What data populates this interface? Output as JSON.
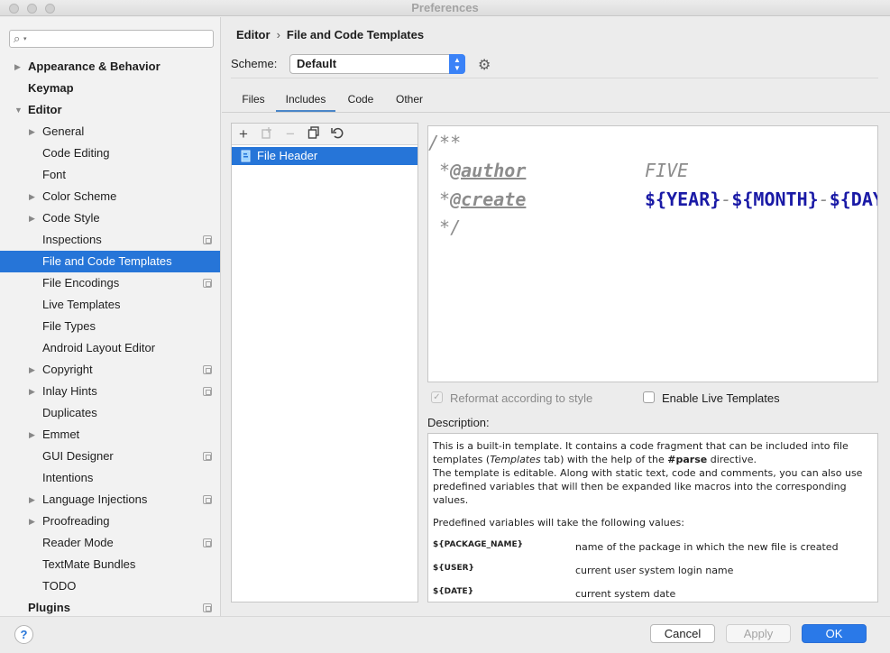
{
  "window": {
    "title": "Preferences"
  },
  "search": {
    "placeholder": "",
    "icon": "search-icon"
  },
  "sidebar": {
    "items": [
      {
        "label": "Appearance & Behavior",
        "level": 0,
        "bold": true,
        "expandable": true,
        "expanded": false,
        "badge": false
      },
      {
        "label": "Keymap",
        "level": 0,
        "bold": true,
        "expandable": false,
        "badge": false
      },
      {
        "label": "Editor",
        "level": 0,
        "bold": true,
        "expandable": true,
        "expanded": true,
        "badge": false
      },
      {
        "label": "General",
        "level": 1,
        "expandable": true,
        "badge": false
      },
      {
        "label": "Code Editing",
        "level": 1,
        "expandable": false,
        "badge": false
      },
      {
        "label": "Font",
        "level": 1,
        "expandable": false,
        "badge": false
      },
      {
        "label": "Color Scheme",
        "level": 1,
        "expandable": true,
        "badge": false
      },
      {
        "label": "Code Style",
        "level": 1,
        "expandable": true,
        "badge": false
      },
      {
        "label": "Inspections",
        "level": 1,
        "expandable": false,
        "badge": true
      },
      {
        "label": "File and Code Templates",
        "level": 1,
        "expandable": false,
        "badge": false,
        "selected": true
      },
      {
        "label": "File Encodings",
        "level": 1,
        "expandable": false,
        "badge": true
      },
      {
        "label": "Live Templates",
        "level": 1,
        "expandable": false,
        "badge": false
      },
      {
        "label": "File Types",
        "level": 1,
        "expandable": false,
        "badge": false
      },
      {
        "label": "Android Layout Editor",
        "level": 1,
        "expandable": false,
        "badge": false
      },
      {
        "label": "Copyright",
        "level": 1,
        "expandable": true,
        "badge": true
      },
      {
        "label": "Inlay Hints",
        "level": 1,
        "expandable": true,
        "badge": true
      },
      {
        "label": "Duplicates",
        "level": 1,
        "expandable": false,
        "badge": false
      },
      {
        "label": "Emmet",
        "level": 1,
        "expandable": true,
        "badge": false
      },
      {
        "label": "GUI Designer",
        "level": 1,
        "expandable": false,
        "badge": true
      },
      {
        "label": "Intentions",
        "level": 1,
        "expandable": false,
        "badge": false
      },
      {
        "label": "Language Injections",
        "level": 1,
        "expandable": true,
        "badge": true
      },
      {
        "label": "Proofreading",
        "level": 1,
        "expandable": true,
        "badge": false
      },
      {
        "label": "Reader Mode",
        "level": 1,
        "expandable": false,
        "badge": true
      },
      {
        "label": "TextMate Bundles",
        "level": 1,
        "expandable": false,
        "badge": false
      },
      {
        "label": "TODO",
        "level": 1,
        "expandable": false,
        "badge": false
      },
      {
        "label": "Plugins",
        "level": 0,
        "bold": true,
        "expandable": false,
        "badge": true
      }
    ]
  },
  "breadcrumb": {
    "parent": "Editor",
    "separator": "›",
    "current": "File and Code Templates"
  },
  "scheme": {
    "label": "Scheme:",
    "value": "Default"
  },
  "tabs": [
    {
      "label": "Files",
      "active": false
    },
    {
      "label": "Includes",
      "active": true
    },
    {
      "label": "Code",
      "active": false
    },
    {
      "label": "Other",
      "active": false
    }
  ],
  "list": {
    "toolbar": [
      "add-icon",
      "copy-template-icon",
      "remove-icon",
      "duplicate-icon",
      "reset-icon"
    ],
    "items": [
      {
        "label": "File Header",
        "selected": true
      }
    ]
  },
  "editor": {
    "lines": [
      {
        "comment": "/**"
      },
      {
        "comment": " *",
        "tag": "@author",
        "value": "FIVE"
      },
      {
        "comment": " *",
        "tag": "@create",
        "vars": [
          "${YEAR}",
          "-",
          "${MONTH}",
          "-",
          "${DAY"
        ]
      },
      {
        "comment": " */"
      }
    ]
  },
  "options": {
    "reformat": {
      "label": "Reformat according to style",
      "checked": true,
      "disabled": true
    },
    "live_templates": {
      "label": "Enable Live Templates",
      "checked": false
    }
  },
  "description": {
    "label": "Description:",
    "p1_a": "This is a built-in template. It contains a code fragment that can be included into file templates (",
    "p1_em": "Templates",
    "p1_b": " tab) with the help of the ",
    "p1_strong": "#parse",
    "p1_c": " directive.",
    "p2": "The template is editable. Along with static text, code and comments, you can also use predefined variables that will then be expanded like macros into the corresponding values.",
    "p3": "Predefined variables will take the following values:",
    "variables": [
      {
        "name": "${PACKAGE_NAME}",
        "desc": "name of the package in which the new file is created"
      },
      {
        "name": "${USER}",
        "desc": "current user system login name"
      },
      {
        "name": "${DATE}",
        "desc": "current system date"
      }
    ]
  },
  "buttons": {
    "help": "?",
    "cancel": "Cancel",
    "apply": "Apply",
    "ok": "OK"
  }
}
